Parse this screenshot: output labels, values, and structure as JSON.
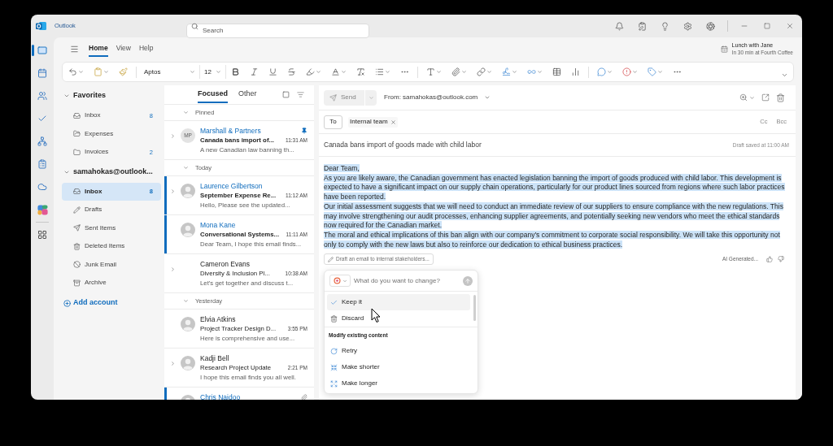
{
  "window": {
    "app_name": "Outlook",
    "search": {
      "placeholder": "Search"
    }
  },
  "app_rail": [
    {
      "selected": true
    },
    {
      "selected": false
    },
    {
      "selected": false
    },
    {
      "selected": false
    },
    {
      "selected": false
    },
    {
      "selected": false
    },
    {
      "selected": false
    },
    {
      "selected": false
    },
    {
      "selected": false
    }
  ],
  "ribbon": {
    "tabs": [
      {
        "label": "Home",
        "selected": true
      },
      {
        "label": "View",
        "selected": false
      },
      {
        "label": "Help",
        "selected": false
      }
    ],
    "reminder": {
      "title": "Lunch with Jane",
      "detail": "In 30 min at Fourth Coffee"
    },
    "toolbar": {
      "font": "Aptos",
      "size": "12"
    }
  },
  "folders": {
    "sections": [
      {
        "label": "Favorites",
        "expanded": true,
        "items": [
          {
            "label": "Inbox",
            "count": "8",
            "selected": false
          },
          {
            "label": "Expenses",
            "selected": false
          },
          {
            "label": "Invoices",
            "count": "2",
            "selected": false
          }
        ]
      },
      {
        "label": "samahokas@outlook...",
        "expanded": true,
        "items": [
          {
            "label": "Inbox",
            "count": "8",
            "selected": true
          },
          {
            "label": "Drafts",
            "selected": false
          },
          {
            "label": "Sent Items",
            "selected": false
          },
          {
            "label": "Deleted Items",
            "selected": false
          },
          {
            "label": "Junk Email",
            "selected": false
          },
          {
            "label": "Archive",
            "selected": false
          }
        ]
      }
    ],
    "add_account": "Add account"
  },
  "message_list": {
    "tabs": [
      {
        "label": "Focused",
        "selected": true
      },
      {
        "label": "Other",
        "selected": false
      }
    ],
    "groups": [
      {
        "label": "Pinned",
        "expanded": true,
        "messages": [
          {
            "sender": "Marshall & Partners",
            "avatar": {
              "kind": "initials",
              "text": "MP"
            },
            "subject": "Canada bans import of...",
            "time": "11:31 AM",
            "preview": "A new Canadian law banning th...",
            "unread": true,
            "marked": false,
            "thread": true,
            "pinned": true,
            "attachment": false
          }
        ]
      },
      {
        "label": "Today",
        "expanded": true,
        "messages": [
          {
            "sender": "Laurence Gilbertson",
            "avatar": {
              "kind": "photo"
            },
            "subject": "September Expense Re...",
            "time": "11:12 AM",
            "preview": "Hello, Please see the updated...",
            "unread": true,
            "marked": true,
            "thread": true,
            "pinned": false,
            "attachment": false
          },
          {
            "sender": "Mona Kane",
            "avatar": {
              "kind": "photo"
            },
            "subject": "Conversational Systems...",
            "time": "11:11 AM",
            "preview": "Dear Team, I hope this email finds...",
            "unread": true,
            "marked": true,
            "thread": false,
            "pinned": false,
            "attachment": false
          },
          {
            "sender": "Cameron Evans",
            "subject": "Diversity & Inclusion Pl...",
            "time": "10:38 AM",
            "preview": "Let's get together and discuss t...",
            "unread": false,
            "marked": false,
            "thread": true,
            "pinned": false,
            "attachment": false
          }
        ]
      },
      {
        "label": "Yesterday",
        "expanded": true,
        "messages": [
          {
            "sender": "Elvia Atkins",
            "avatar": {
              "kind": "photo"
            },
            "subject": "Project Tracker Design D...",
            "time": "3:55 PM",
            "preview": "Here is comprehensive and use...",
            "unread": false,
            "marked": false,
            "thread": false,
            "pinned": false,
            "attachment": false
          },
          {
            "sender": "Kadji Bell",
            "avatar": {
              "kind": "photo"
            },
            "subject": "Research Project Update",
            "time": "2:21 PM",
            "preview": "I hope this email finds you all well.",
            "unread": false,
            "marked": false,
            "thread": true,
            "pinned": false,
            "attachment": false
          },
          {
            "sender": "Chris Naidoo",
            "avatar": {
              "kind": "photo"
            },
            "unread": true,
            "marked": true,
            "thread": false,
            "pinned": false,
            "attachment": true
          }
        ]
      }
    ]
  },
  "compose": {
    "send": {
      "label": "Send",
      "disabled": true
    },
    "from": "From: samahokas@outlook.com",
    "to_label": "To",
    "recipients": [
      {
        "name": "Internal team"
      }
    ],
    "cc": "Cc",
    "bcc": "Bcc",
    "subject": "Canada bans import of goods made with child labor",
    "draft_status": "Draft saved at 11:00 AM",
    "body": {
      "selected": true,
      "paragraphs": [
        "Dear Team,",
        "As you are likely aware, the Canadian government has enacted legislation banning the import of goods produced with child labor. This development is expected to have a significant impact on our supply chain operations, particularly for our product lines sourced from regions where such labor practices have been reported.",
        "Our initial assessment suggests that we will need to conduct an immediate review of our suppliers to ensure compliance with the new regulations. This may involve strengthening our audit processes, enhancing supplier agreements, and potentially seeking new vendors who meet the ethical standards now required for the Canadian market.",
        "The moral and ethical implications of this ban align with our company’s commitment to corporate social responsibility. We will take this opportunity not only to comply with the new laws but also to reinforce our dedication to ethical business practices."
      ]
    },
    "prompt": "Draft an email to internal stakeholders...",
    "ai_label": "AI Generated..."
  },
  "copilot_popup": {
    "placeholder": "What do you want to change?",
    "menu": [
      {
        "kind": "action",
        "label": "Keep it",
        "highlighted": true
      },
      {
        "kind": "action",
        "label": "Discard",
        "highlighted": false
      },
      {
        "kind": "header",
        "label": "Modify existing content"
      },
      {
        "kind": "action",
        "label": "Retry",
        "highlighted": false
      },
      {
        "kind": "action",
        "label": "Make shorter",
        "highlighted": false
      },
      {
        "kind": "action",
        "label": "Make longer",
        "highlighted": false
      }
    ]
  }
}
